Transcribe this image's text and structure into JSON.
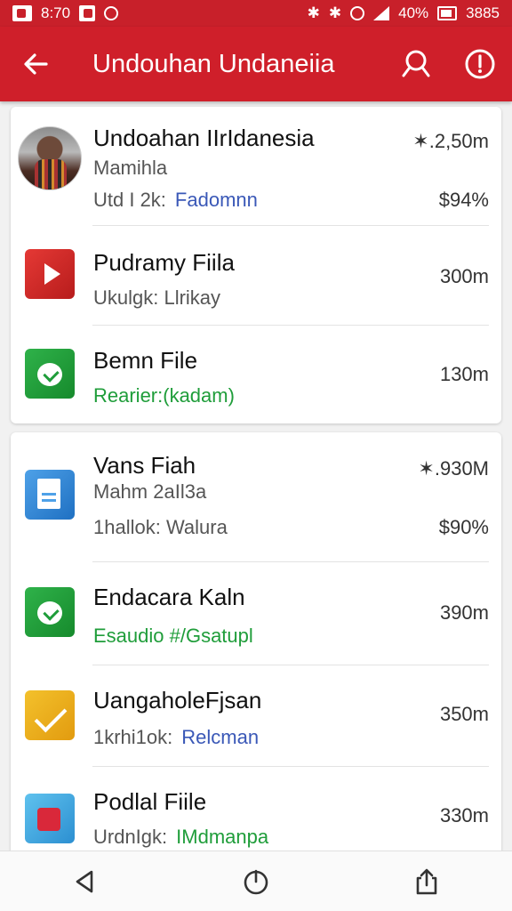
{
  "status_bar": {
    "time": "8:70",
    "battery": "40%",
    "extra": "3885"
  },
  "header": {
    "title": "Undouhan Undaneiia",
    "icons": [
      "back-arrow-icon",
      "search-icon",
      "alert-icon"
    ]
  },
  "colors": {
    "header": "#cf1f2a",
    "accent_blue": "#3a58b7",
    "accent_green": "#1f9d3a"
  },
  "downloads": [
    {
      "title": "Undoahan IIrIdanesia",
      "subtitle": "Mamihla",
      "meta": "Utd I 2k:",
      "meta_accent": "Fadomnn",
      "size": "✶.2,50m",
      "percent": "$94%",
      "icon": "avatar"
    },
    {
      "title": "Pudramy Fiila",
      "subtitle": "Ukulgk: Llrikay",
      "size": "300m",
      "icon": "play-icon"
    },
    {
      "title": "Bemn File",
      "subtitle": "Rearier:(kadam)",
      "size": "130m",
      "icon": "check-app-icon"
    },
    {
      "title": "Vans Fiah",
      "subtitle": "Mahm 2aIl3a",
      "meta": "1hallok: Walura",
      "size": "✶.930M",
      "percent": "$90%",
      "icon": "document-icon"
    },
    {
      "title": "Endacara Kaln",
      "subtitle": "Esaudio #/Gsatupl",
      "size": "390m",
      "icon": "green-app-icon"
    },
    {
      "title": "UangaholeFjsan",
      "subtitle": "1krhi1ok:",
      "subtitle_accent": "Relcman",
      "size": "350m",
      "icon": "mail-icon"
    },
    {
      "title": "Podlal Fiile",
      "subtitle": "UrdnIgk:",
      "subtitle_accent": "IMdmanpa",
      "size": "330m",
      "icon": "red-app-icon"
    }
  ],
  "nav": [
    "back-nav-icon",
    "home-nav-icon",
    "share-nav-icon"
  ]
}
